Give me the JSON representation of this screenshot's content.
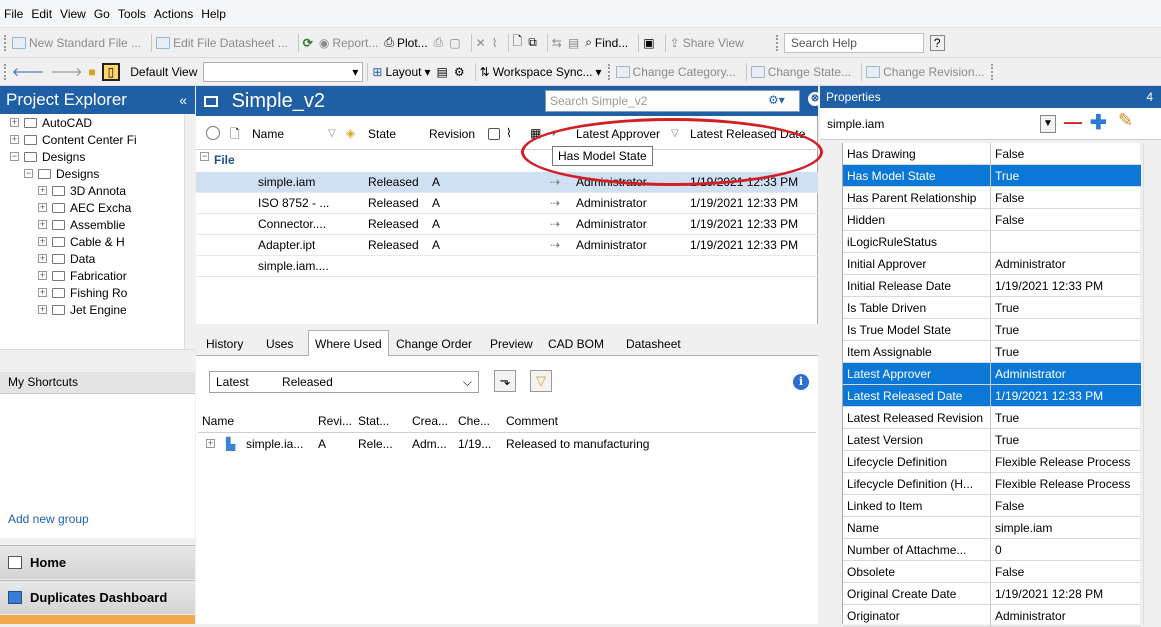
{
  "menu": [
    "File",
    "Edit",
    "View",
    "Go",
    "Tools",
    "Actions",
    "Help"
  ],
  "toolbar1": {
    "new_std_file": "New Standard File ...",
    "edit_datasheet": "Edit File Datasheet ...",
    "report": "Report...",
    "plot": "Plot...",
    "find": "Find...",
    "share_view": "Share View",
    "search_help": "Search Help"
  },
  "toolbar2": {
    "view": "Default View",
    "layout": "Layout",
    "workspace_sync": "Workspace Sync...",
    "change_category": "Change Category...",
    "change_state": "Change State...",
    "change_revision": "Change Revision..."
  },
  "explorer": {
    "title": "Project Explorer",
    "collapse": "«",
    "tree": [
      {
        "label": "AutoCAD",
        "indent": 1
      },
      {
        "label": "Content Center Fi",
        "indent": 1
      },
      {
        "label": "Designs",
        "indent": 1
      },
      {
        "label": "Designs",
        "indent": 2
      },
      {
        "label": "3D Annota",
        "indent": 3
      },
      {
        "label": "AEC Excha",
        "indent": 3
      },
      {
        "label": "Assemblie",
        "indent": 3
      },
      {
        "label": "Cable & H",
        "indent": 3
      },
      {
        "label": "Data",
        "indent": 3
      },
      {
        "label": "Fabricatior",
        "indent": 3
      },
      {
        "label": "Fishing Ro",
        "indent": 3
      },
      {
        "label": "Jet Engine",
        "indent": 3
      }
    ],
    "shortcuts": "My Shortcuts",
    "add_group": "Add new group",
    "home": "Home",
    "duplicates": "Duplicates Dashboard"
  },
  "main": {
    "title": "Simple_v2",
    "search_placeholder": "Search Simple_v2",
    "columns": {
      "name": "Name",
      "state": "State",
      "revision": "Revision",
      "latest_approver": "Latest Approver",
      "latest_released_date": "Latest Released Date"
    },
    "group": "File",
    "rows": [
      {
        "name": "simple.iam",
        "state": "Released",
        "rev": "A",
        "approver": "Administrator",
        "date": "1/19/2021 12:33 PM"
      },
      {
        "name": "ISO 8752 - ...",
        "state": "Released",
        "rev": "A",
        "approver": "Administrator",
        "date": "1/19/2021 12:33 PM"
      },
      {
        "name": "Connector....",
        "state": "Released",
        "rev": "A",
        "approver": "Administrator",
        "date": "1/19/2021 12:33 PM"
      },
      {
        "name": "Adapter.ipt",
        "state": "Released",
        "rev": "A",
        "approver": "Administrator",
        "date": "1/19/2021 12:33 PM"
      },
      {
        "name": "simple.iam....",
        "state": "",
        "rev": "",
        "approver": "",
        "date": ""
      }
    ],
    "tooltip": "Has Model State"
  },
  "tabs": [
    "History",
    "Uses",
    "Where Used",
    "Change Order",
    "Preview",
    "CAD BOM",
    "Datasheet"
  ],
  "where_used": {
    "filter_1": "Latest",
    "filter_2": "Released",
    "columns": [
      "Name",
      "Revi...",
      "Stat...",
      "Crea...",
      "Che...",
      "Comment"
    ],
    "row": {
      "name": "simple.ia...",
      "rev": "A",
      "state": "Rele...",
      "created": "Adm...",
      "checked": "1/19...",
      "comment": "Released to manufacturing"
    }
  },
  "properties": {
    "title": "Properties",
    "pin": "4",
    "selected": "simple.iam",
    "rows": [
      {
        "k": "Has Drawing",
        "v": "False",
        "sel": false
      },
      {
        "k": "Has Model State",
        "v": "True",
        "sel": true
      },
      {
        "k": "Has Parent Relationship",
        "v": "False",
        "sel": false
      },
      {
        "k": "Hidden",
        "v": "False",
        "sel": false
      },
      {
        "k": "iLogicRuleStatus",
        "v": "",
        "sel": false
      },
      {
        "k": "Initial Approver",
        "v": "Administrator",
        "sel": false
      },
      {
        "k": "Initial Release Date",
        "v": "1/19/2021 12:33 PM",
        "sel": false
      },
      {
        "k": "Is Table Driven",
        "v": "True",
        "sel": false
      },
      {
        "k": "Is True Model State",
        "v": "True",
        "sel": false
      },
      {
        "k": "Item Assignable",
        "v": "True",
        "sel": false
      },
      {
        "k": "Latest Approver",
        "v": "Administrator",
        "sel": true
      },
      {
        "k": "Latest Released Date",
        "v": "1/19/2021 12:33 PM",
        "sel": true
      },
      {
        "k": "Latest Released Revision",
        "v": "True",
        "sel": false
      },
      {
        "k": "Latest Version",
        "v": "True",
        "sel": false
      },
      {
        "k": "Lifecycle Definition",
        "v": "Flexible Release Process",
        "sel": false
      },
      {
        "k": "Lifecycle Definition (H...",
        "v": "Flexible Release Process",
        "sel": false
      },
      {
        "k": "Linked to Item",
        "v": "False",
        "sel": false
      },
      {
        "k": "Name",
        "v": "simple.iam",
        "sel": false
      },
      {
        "k": "Number of Attachme...",
        "v": "0",
        "sel": false
      },
      {
        "k": "Obsolete",
        "v": "False",
        "sel": false
      },
      {
        "k": "Original Create Date",
        "v": "1/19/2021 12:28 PM",
        "sel": false
      },
      {
        "k": "Originator",
        "v": "Administrator",
        "sel": false
      }
    ]
  },
  "colors": {
    "header_blue": "#1f5fa6",
    "selection_blue": "#0b78d7",
    "callout_red": "#d21f24"
  }
}
